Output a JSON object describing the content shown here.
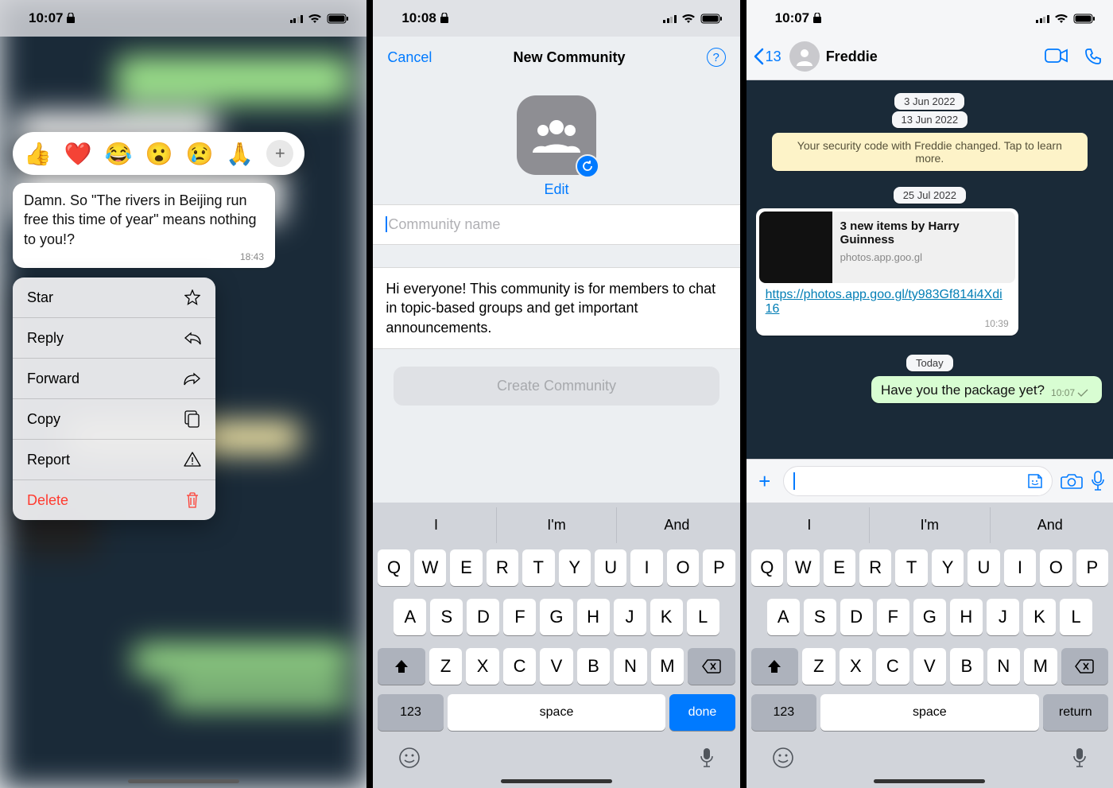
{
  "phone1": {
    "status_time": "10:07",
    "reactions": [
      "👍",
      "❤️",
      "😂",
      "😮",
      "😢",
      "🙏"
    ],
    "message_text": "Damn. So \"The rivers in Beijing run free this time of year\" means nothing to you!?",
    "message_time": "18:43",
    "menu": {
      "star": "Star",
      "reply": "Reply",
      "forward": "Forward",
      "copy": "Copy",
      "report": "Report",
      "delete": "Delete"
    }
  },
  "phone2": {
    "status_time": "10:08",
    "header": {
      "cancel": "Cancel",
      "title": "New Community"
    },
    "edit_label": "Edit",
    "name_placeholder": "Community name",
    "description": "Hi everyone! This community is for members to chat in topic-based groups and get important announcements.",
    "create_btn": "Create Community",
    "suggestions": [
      "I",
      "I'm",
      "And"
    ],
    "key_123": "123",
    "key_space": "space",
    "key_action": "done"
  },
  "phone3": {
    "status_time": "10:07",
    "back_count": "13",
    "contact_name": "Freddie",
    "dates": {
      "d1": "3 Jun 2022",
      "d2": "13 Jun 2022",
      "d3": "25 Jul 2022",
      "today": "Today"
    },
    "security_notice": "Your security code with Freddie changed. Tap to learn more.",
    "link_card": {
      "title": "3 new items by Harry Guinness",
      "host": "photos.app.goo.gl",
      "url": "https://photos.app.goo.gl/ty983Gf814i4Xdi16",
      "time": "10:39"
    },
    "out_msg": {
      "text": "Have you the package yet?",
      "time": "10:07"
    },
    "suggestions": [
      "I",
      "I'm",
      "And"
    ],
    "key_123": "123",
    "key_space": "space",
    "key_action": "return"
  },
  "keys": {
    "row1": [
      "Q",
      "W",
      "E",
      "R",
      "T",
      "Y",
      "U",
      "I",
      "O",
      "P"
    ],
    "row2": [
      "A",
      "S",
      "D",
      "F",
      "G",
      "H",
      "J",
      "K",
      "L"
    ],
    "row3": [
      "Z",
      "X",
      "C",
      "V",
      "B",
      "N",
      "M"
    ]
  }
}
